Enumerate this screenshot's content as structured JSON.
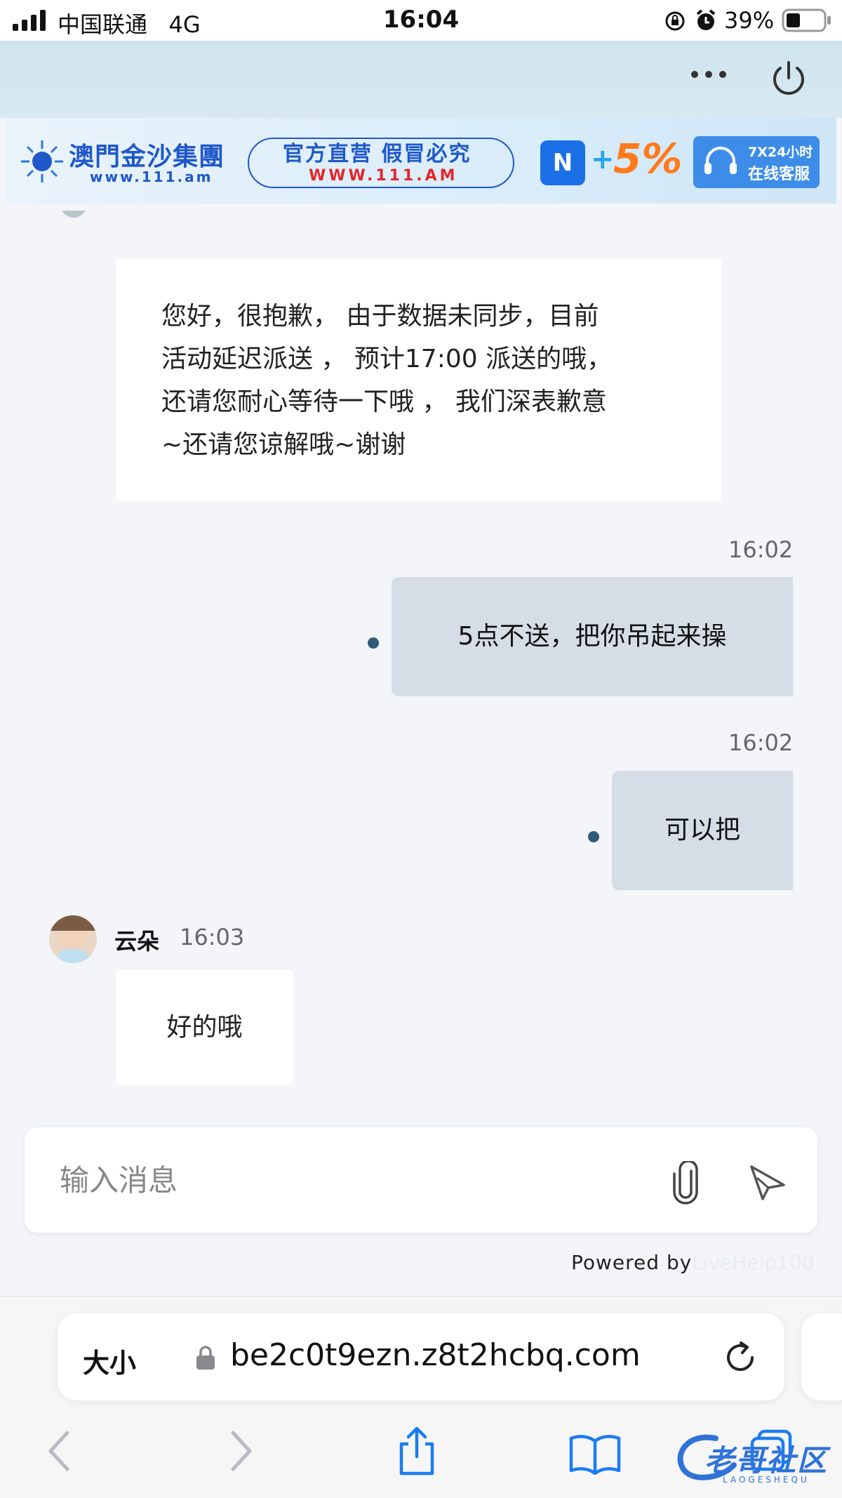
{
  "status_bar": {
    "carrier": "中国联通",
    "network": "4G",
    "time": "16:04",
    "battery": "39%",
    "battery_level": 0.39
  },
  "header": {
    "more_icon": "more-horizontal-icon",
    "power_icon": "power-icon"
  },
  "banner": {
    "brand_name": "澳門金沙集團",
    "brand_url": "www.111.am",
    "slogan": "官方直营 假冒必究",
    "slogan_url": "WWW.111.AM",
    "badge_text": "N",
    "plus": "+",
    "bonus": "5%",
    "service_line1": "7X24小时",
    "service_line2": "在线客服"
  },
  "messages": [
    {
      "direction": "in",
      "lines": [
        "您好，很抱歉， 由于数据未同步，目前",
        "活动延迟派送 ， 预计17:00 派送的哦，",
        "还请您耐心等待一下哦 ， 我们深表歉意",
        "~还请您谅解哦~谢谢"
      ]
    },
    {
      "direction": "out",
      "time": "16:02",
      "text": "5点不送，把你吊起来操"
    },
    {
      "direction": "out",
      "time": "16:02",
      "text": "可以把"
    },
    {
      "direction": "in",
      "sender": "云朵",
      "time": "16:03",
      "text": "好的哦"
    }
  ],
  "composer": {
    "placeholder": "输入消息",
    "attach_icon": "paperclip-icon",
    "send_icon": "send-icon"
  },
  "footer": {
    "powered_by": "Powered by",
    "powered_link": "LiveHelp100"
  },
  "safari": {
    "text_size": "大小",
    "url": "be2c0t9ezn.z8t2hcbq.com",
    "reload_icon": "reload-icon",
    "toolbar": [
      "back-icon",
      "forward-icon",
      "share-icon",
      "bookmarks-icon",
      "tabs-icon"
    ]
  },
  "watermark": {
    "text": "老哥社区",
    "sub": "LAOGESHEQU"
  },
  "colors": {
    "outgoing_bubble": "#d5dde6",
    "incoming_bubble": "#ffffff",
    "chat_bg": "#f3f5f8",
    "header_bg": "#d3e6ef",
    "safari_blue": "#1a7cf2"
  }
}
